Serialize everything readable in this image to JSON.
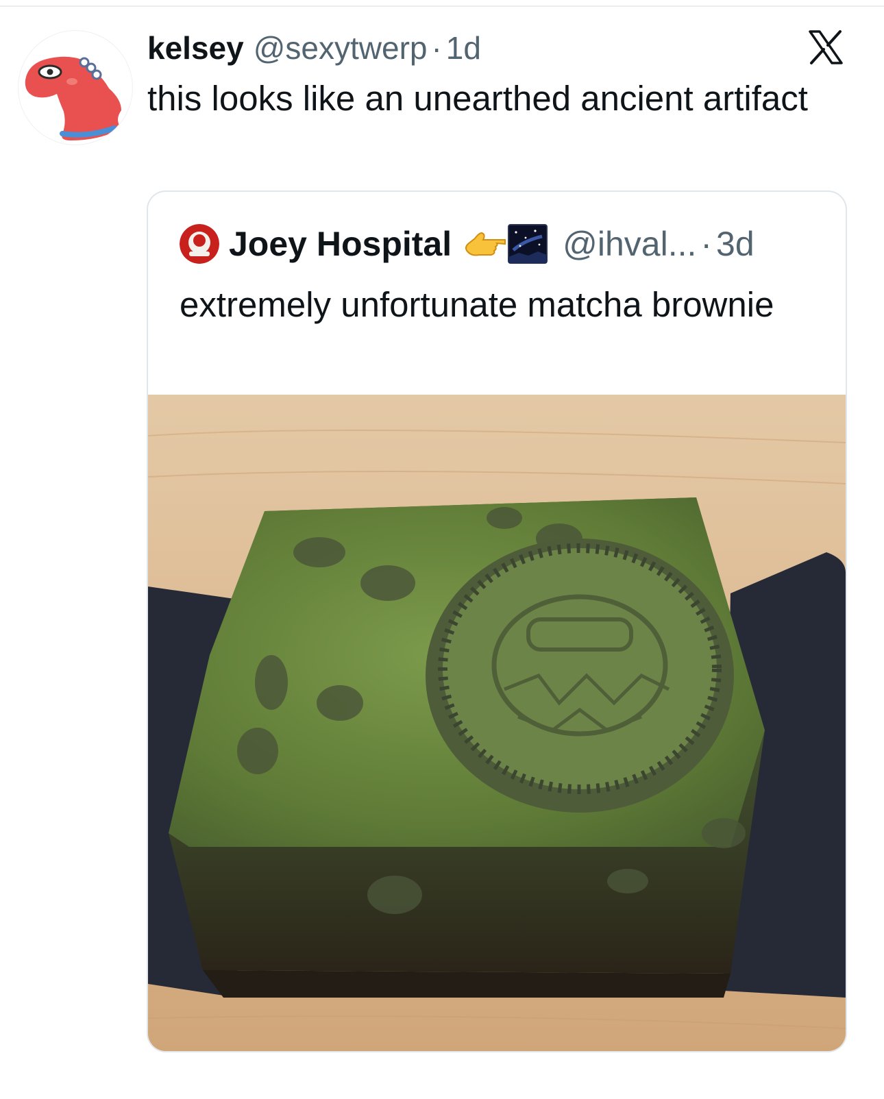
{
  "tweet": {
    "name": "kelsey",
    "handle": "@sexytwerp",
    "separator": "·",
    "time": "1d",
    "text": "this looks like an unearthed ancient artifact"
  },
  "quote": {
    "name": "Joey Hospital",
    "handle": "@ihval...",
    "separator": "·",
    "time": "3d",
    "text": "extremely unfortunate matcha brownie",
    "emoji": "backhand-index-pointing-left-emoji",
    "badge": "night-sky-badge-icon"
  },
  "colors": {
    "text_primary": "#0f1419",
    "text_secondary": "#536471",
    "border": "#e1e6ea",
    "avatar_red": "#e8514f",
    "matcha_green": "#6f8a3f"
  }
}
